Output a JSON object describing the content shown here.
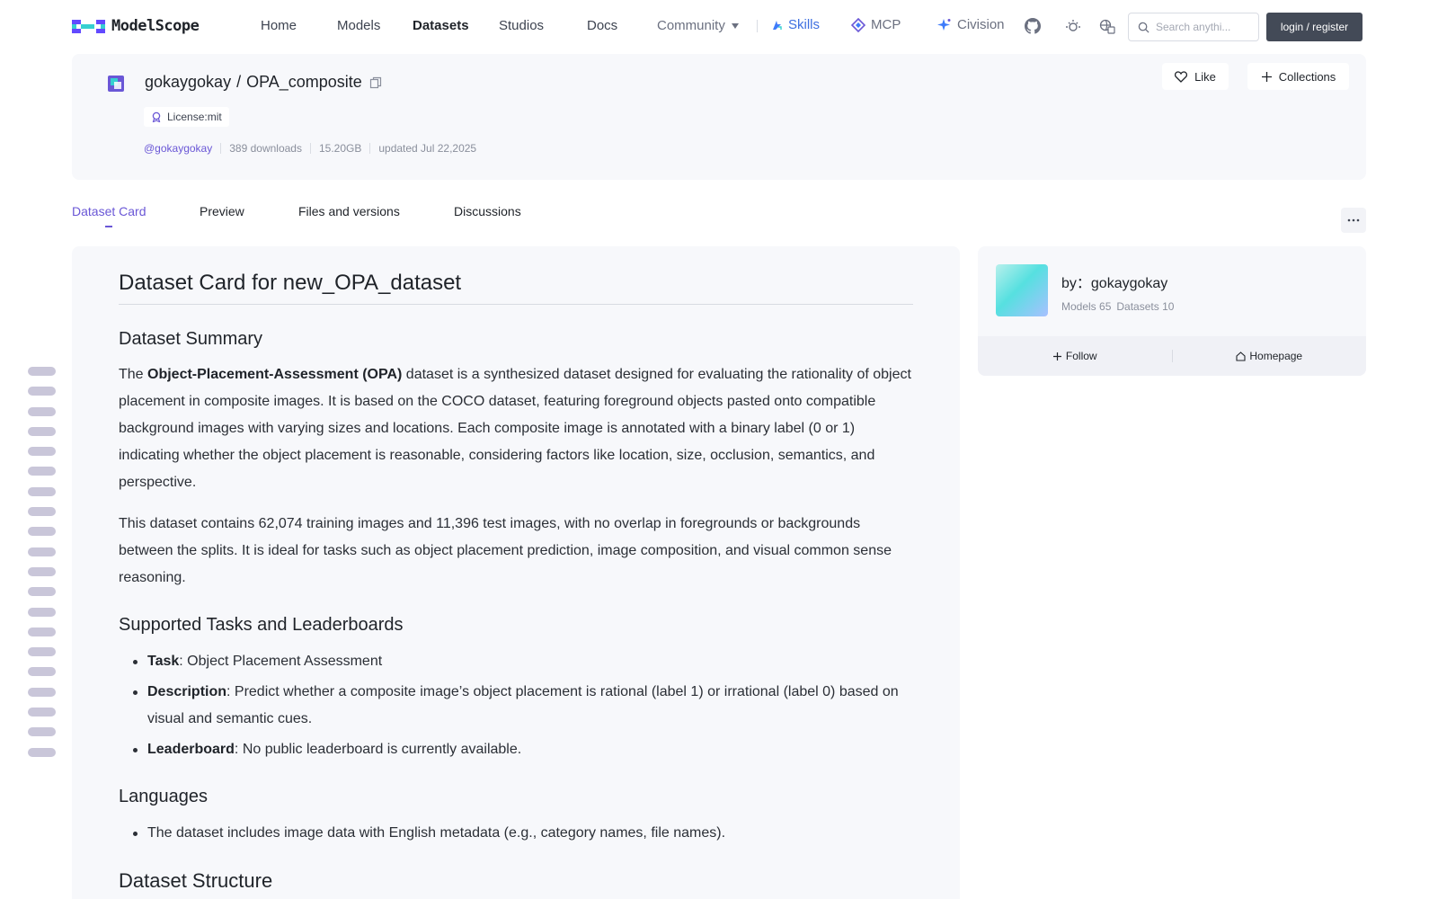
{
  "brand": {
    "name": "ModelScope",
    "accent": "#6a57d6"
  },
  "nav": {
    "items": [
      "Home",
      "Models",
      "Datasets",
      "Studios",
      "Docs",
      "Community"
    ],
    "skills": "Skills",
    "mcp": "MCP",
    "civision": "Civision",
    "search_placeholder": "Search anythi...",
    "login": "login / register"
  },
  "dataset": {
    "owner": "gokaygokay",
    "name": "OPA_composite",
    "license": "License:mit",
    "owner_handle": "@gokaygokay",
    "downloads": "389 downloads",
    "size": "15.20GB",
    "updated": "updated Jul 22,2025",
    "like": "Like",
    "collections": "Collections"
  },
  "tabs": [
    "Dataset Card",
    "Preview",
    "Files and versions",
    "Discussions"
  ],
  "readme": {
    "title": "Dataset Card for new_OPA_dataset",
    "summary_heading": "Dataset Summary",
    "summary_p1_pre": "The ",
    "summary_p1_bold": "Object-Placement-Assessment (OPA)",
    "summary_p1_post": " dataset is a synthesized dataset designed for evaluating the rationality of object placement in composite images. It is based on the COCO dataset, featuring foreground objects pasted onto compatible background images with varying sizes and locations. Each composite image is annotated with a binary label (0 or 1) indicating whether the object placement is reasonable, considering factors like location, size, occlusion, semantics, and perspective.",
    "summary_p2": "This dataset contains 62,074 training images and 11,396 test images, with no overlap in foregrounds or backgrounds between the splits. It is ideal for tasks such as object placement prediction, image composition, and visual common sense reasoning.",
    "tasks_heading": "Supported Tasks and Leaderboards",
    "tasks": [
      {
        "key": "Task",
        "value": ": Object Placement Assessment"
      },
      {
        "key": "Description",
        "value": ": Predict whether a composite image’s object placement is rational (label 1) or irrational (label 0) based on visual and semantic cues."
      },
      {
        "key": "Leaderboard",
        "value": ": No public leaderboard is currently available."
      }
    ],
    "languages_heading": "Languages",
    "languages_item": "The dataset includes image data with English metadata (e.g., category names, file names).",
    "structure_heading": "Dataset Structure"
  },
  "author": {
    "by": "by：gokaygokay",
    "models": "Models 65",
    "datasets": "Datasets 10",
    "follow": "Follow",
    "homepage": "Homepage"
  }
}
